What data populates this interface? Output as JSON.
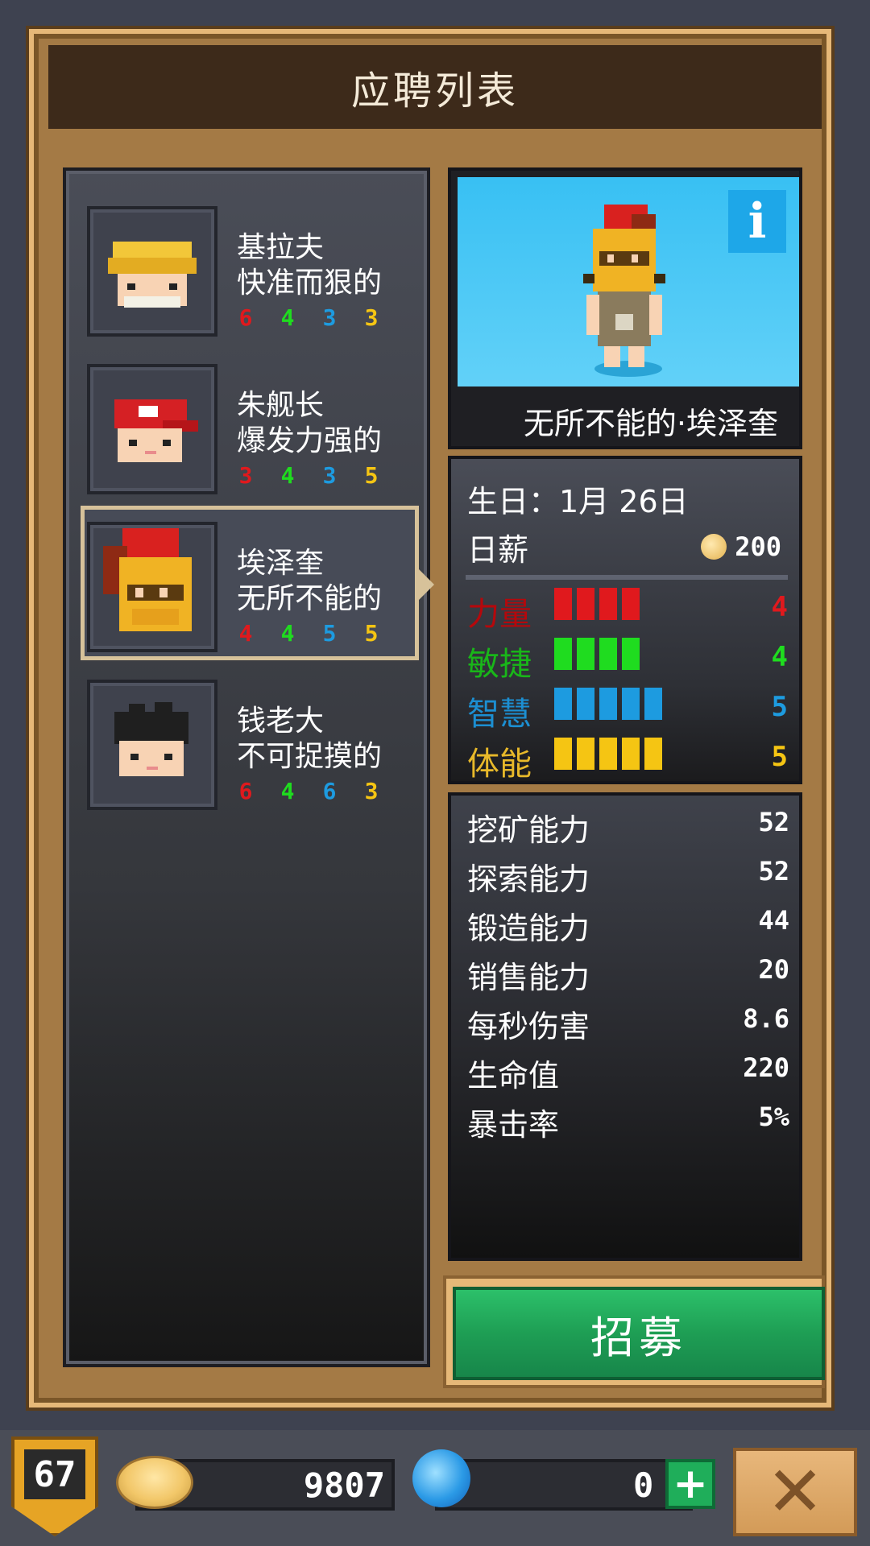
{
  "header": {
    "title": "应聘列表"
  },
  "candidates": [
    {
      "name": "基拉夫",
      "trait": "快准而狠的",
      "stats": [
        "6",
        "4",
        "3",
        "3"
      ],
      "selected": false,
      "portrait": "blonde-worker"
    },
    {
      "name": "朱舰长",
      "trait": "爆发力强的",
      "stats": [
        "3",
        "4",
        "3",
        "5"
      ],
      "selected": false,
      "portrait": "red-cap"
    },
    {
      "name": "埃泽奎",
      "trait": "无所不能的",
      "stats": [
        "4",
        "4",
        "5",
        "5"
      ],
      "selected": true,
      "portrait": "golden-helmet"
    },
    {
      "name": "钱老大",
      "trait": "不可捉摸的",
      "stats": [
        "6",
        "4",
        "6",
        "3"
      ],
      "selected": false,
      "portrait": "black-hair"
    }
  ],
  "stat_colors": [
    "#e0191d",
    "#1fdc1f",
    "#1d9be0",
    "#f5c513"
  ],
  "detail": {
    "hero_title": "无所不能的·埃泽奎",
    "info_label": "i",
    "birthday_label": "生日：",
    "birthday_value": "1月 26日",
    "salary_label": "日薪",
    "salary_value": "200",
    "attributes": [
      {
        "label": "力量",
        "value": "4",
        "color": "#e0191d",
        "label_color": "#b5080c"
      },
      {
        "label": "敏捷",
        "value": "4",
        "color": "#1fdc1f",
        "label_color": "#19b619"
      },
      {
        "label": "智慧",
        "value": "5",
        "color": "#1d9be0",
        "label_color": "#1c8fd2"
      },
      {
        "label": "体能",
        "value": "5",
        "color": "#f5c513",
        "label_color": "#e8b92a"
      }
    ],
    "abilities": [
      {
        "label": "挖矿能力",
        "value": "52"
      },
      {
        "label": "探索能力",
        "value": "52"
      },
      {
        "label": "锻造能力",
        "value": "44"
      },
      {
        "label": "销售能力",
        "value": "20"
      },
      {
        "label": "每秒伤害",
        "value": "8.6"
      },
      {
        "label": "生命值",
        "value": "220"
      },
      {
        "label": "暴击率",
        "value": "5%"
      }
    ]
  },
  "recruit_button": "招募",
  "bottom": {
    "level": "67",
    "gold": "9807",
    "gems": "0",
    "plus_label": "+",
    "close_label": "✕"
  }
}
